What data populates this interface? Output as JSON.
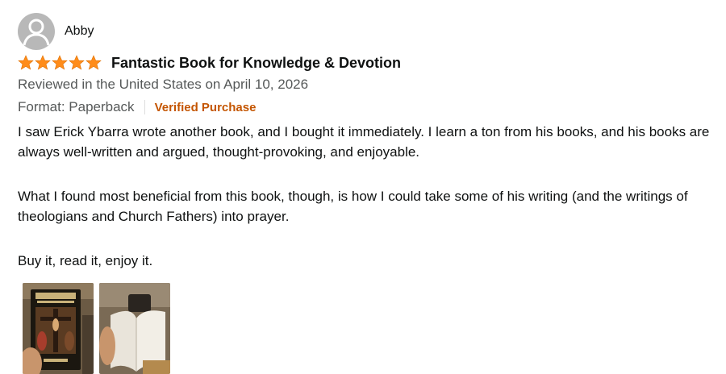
{
  "review": {
    "author": "Abby",
    "rating": 5,
    "rating_max": 5,
    "title": "Fantastic Book for Knowledge & Devotion",
    "reviewed_in": "Reviewed in the United States on April 10, 2026",
    "format": "Format: Paperback",
    "verified": "Verified Purchase",
    "paragraphs": [
      "I saw Erick Ybarra wrote another book, and I bought it immediately. I learn a ton from his books, and his books are always well-written and argued, thought-provoking, and enjoyable.",
      "What I found most beneficial from this book, though, is how I could take some of his writing (and the writings of theologians and Church Fathers) into prayer.",
      "Buy it, read it, enjoy it."
    ],
    "images": [
      "review-photo-book-cover",
      "review-photo-open-book"
    ]
  },
  "colors": {
    "star": "#ff8c1a",
    "verified": "#c45500",
    "secondary_text": "#565959"
  }
}
